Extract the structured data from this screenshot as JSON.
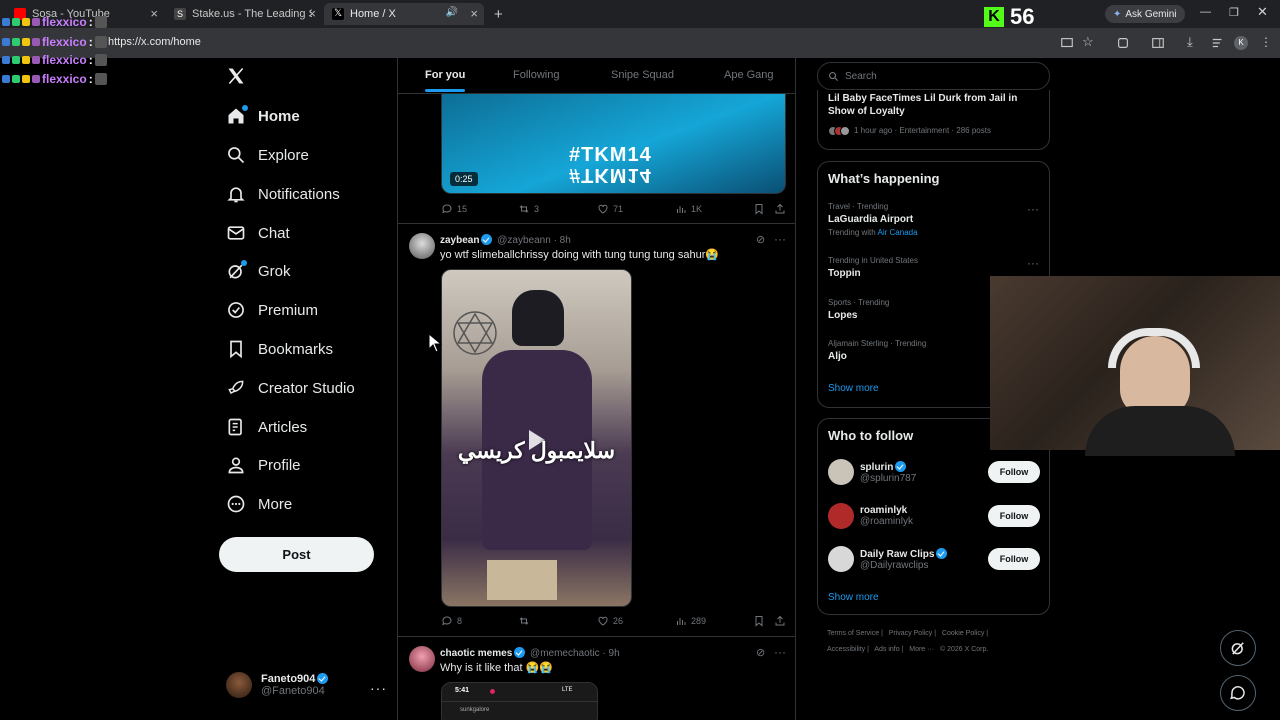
{
  "browser": {
    "tabs": [
      {
        "label": "Sosa - YouTube",
        "favicon_color": "#ff0000",
        "active": false
      },
      {
        "label": "Stake.us - The Leading Social C",
        "favicon_color": "#e8e8e8",
        "active": false
      },
      {
        "label": "Home / X",
        "favicon_color": "#ffffff",
        "active": true
      }
    ],
    "new_tab": "+",
    "url": "https://x.com/home",
    "ask_gemini": "Ask Gemini",
    "profile_initial": "K",
    "counter": "56"
  },
  "overlay": {
    "user": "flexxico",
    "colon": ":"
  },
  "sidebar": {
    "items": [
      {
        "label": "Home",
        "icon": "home-icon"
      },
      {
        "label": "Explore",
        "icon": "search-icon"
      },
      {
        "label": "Notifications",
        "icon": "bell-icon"
      },
      {
        "label": "Chat",
        "icon": "mail-icon"
      },
      {
        "label": "Grok",
        "icon": "grok-icon"
      },
      {
        "label": "Premium",
        "icon": "premium-icon"
      },
      {
        "label": "Bookmarks",
        "icon": "bookmark-icon"
      },
      {
        "label": "Creator Studio",
        "icon": "rocket-icon"
      },
      {
        "label": "Articles",
        "icon": "articles-icon"
      },
      {
        "label": "Profile",
        "icon": "person-icon"
      },
      {
        "label": "More",
        "icon": "more-icon"
      }
    ],
    "post_label": "Post",
    "account": {
      "name": "Faneto904",
      "handle": "@Faneto904"
    }
  },
  "feed": {
    "tabs": [
      "For you",
      "Following",
      "Snipe Squad",
      "Ape Gang"
    ],
    "post1": {
      "hashtag_top": "#TKM14",
      "hashtag_bottom": "#TKM14",
      "duration": "0:25",
      "replies": "15",
      "reposts": "3",
      "likes": "71",
      "views": "1K"
    },
    "post2": {
      "name": "zaybean",
      "handle": "@zaybeann",
      "time": "· 8h",
      "text": "yo wtf slimeballchrissy doing with tung tung tung sahur😭",
      "video_caption": "سلايمبول كريسي",
      "replies": "8",
      "reposts": "",
      "likes": "26",
      "views": "289"
    },
    "post3": {
      "name": "chaotic memes",
      "handle": "@memechaotic",
      "time": "· 9h",
      "text": "Why is it like that 😭😭",
      "phone_time": "5:41",
      "phone_status": "LTE",
      "phone_user": "sunkgalore"
    }
  },
  "right": {
    "search_placeholder": "Search",
    "top_trend": {
      "title": "Lil Baby FaceTimes Lil Durk from Jail in Show of Loyalty",
      "meta": "1 hour ago · Entertainment · 286 posts"
    },
    "happening_title": "What’s happening",
    "trends": [
      {
        "meta": "Travel · Trending",
        "topic": "LaGuardia Airport",
        "with_prefix": "Trending with ",
        "with_link": "Air Canada"
      },
      {
        "meta": "Trending in United States",
        "topic": "Toppin"
      },
      {
        "meta": "Sports · Trending",
        "topic": "Lopes"
      },
      {
        "meta": "Aljamain Sterling · Trending",
        "topic": "Aljo"
      }
    ],
    "show_more": "Show more",
    "who_title": "Who to follow",
    "follow": [
      {
        "name": "splurin",
        "handle": "@splurin787",
        "avatar_color": "#c9c3b8"
      },
      {
        "name": "roaminlyk",
        "handle": "@roaminlyk",
        "avatar_color": "#b02a2a"
      },
      {
        "name": "Daily Raw Clips",
        "handle": "@Dailyrawclips",
        "avatar_color": "#d8d8d8"
      }
    ],
    "follow_label": "Follow",
    "footer": {
      "line1": [
        "Terms of Service",
        "Privacy Policy",
        "Cookie Policy"
      ],
      "line2": [
        "Accessibility",
        "Ads info",
        "More ···",
        "© 2026 X Corp."
      ]
    }
  },
  "colors": {
    "accent": "#1d9bf0",
    "bg": "#000000",
    "border": "#2f3336",
    "muted": "#71767b"
  }
}
